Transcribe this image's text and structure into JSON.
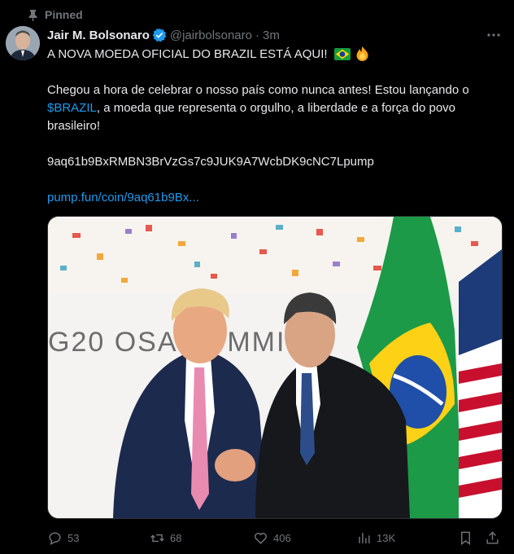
{
  "pinned_label": "Pinned",
  "author": {
    "name": "Jair M. Bolsonaro",
    "handle": "@jairbolsonaro",
    "separator": "·",
    "time": "3m",
    "verified_color": "#1d9bf0"
  },
  "tweet": {
    "headline": "A NOVA MOEDA OFICIAL DO BRAZIL ESTÁ AQUI!",
    "headline_emojis": [
      "brazil-flag",
      "fire"
    ],
    "para_before_link": "Chegou a hora de celebrar o nosso país como nunca antes! Estou lançando o ",
    "cashtag": "$BRAZIL",
    "para_after_link": ", a moeda que representa o orgulho, a liberdade e a força do povo brasileiro!",
    "contract": "9aq61b9BxRMBN3BrVzGs7c9JUK9A7WcbDK9cNC7Lpump",
    "url": "pump.fun/coin/9aq61b9Bx..."
  },
  "media": {
    "backdrop_text": "G20 OSA   SUMMIT",
    "description_icon": "photo-two-men-handshake"
  },
  "stats": {
    "replies": "53",
    "reposts": "68",
    "likes": "406",
    "views": "13K"
  },
  "colors": {
    "link": "#1d9bf0",
    "muted": "#71767b",
    "background": "#000000"
  }
}
